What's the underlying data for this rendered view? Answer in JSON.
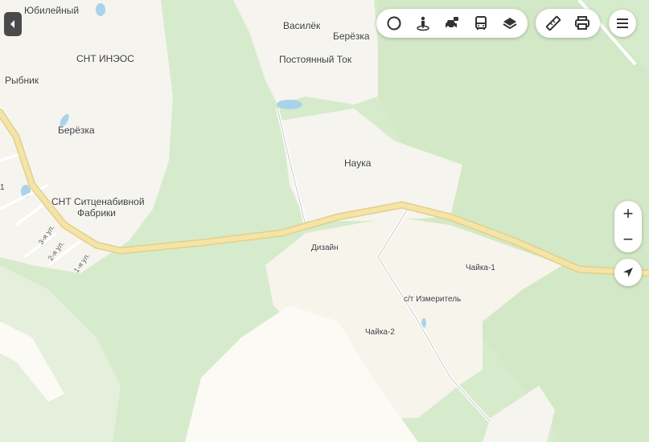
{
  "map": {
    "places": [
      {
        "id": "yubileyny",
        "text": "Юбилейный"
      },
      {
        "id": "snt-inzos",
        "text": "СНТ ИНЭОС"
      },
      {
        "id": "rybnik",
        "text": "Рыбник"
      },
      {
        "id": "beryozka-west",
        "text": "Берёзка"
      },
      {
        "id": "snt-sitcenabivnoy-1",
        "text": "СНТ Ситценабивной"
      },
      {
        "id": "snt-sitcenabivnoy-2",
        "text": "Фабрики"
      },
      {
        "id": "vasilyok",
        "text": "Василёк"
      },
      {
        "id": "beryozka-north",
        "text": "Берёзка"
      },
      {
        "id": "postoyanny-tok",
        "text": "Постоянный Ток"
      },
      {
        "id": "nauka",
        "text": "Наука"
      },
      {
        "id": "dizain",
        "text": "Дизайн"
      },
      {
        "id": "chayka-1",
        "text": "Чайка-1"
      },
      {
        "id": "st-izmeritel",
        "text": "с/т Измеритель"
      },
      {
        "id": "chayka-2",
        "text": "Чайка-2"
      },
      {
        "id": "edge-number",
        "text": "1"
      }
    ],
    "streets": [
      {
        "id": "street-3",
        "text": "3-я ул."
      },
      {
        "id": "street-2",
        "text": "2-я ул."
      },
      {
        "id": "street-1",
        "text": "1-я ул."
      }
    ]
  },
  "controls": {
    "top_layers": [
      "traffic-circle-icon",
      "panorama-person-icon",
      "car-sharing-icon",
      "bus-icon",
      "layers-icon"
    ],
    "tools": [
      "ruler-icon",
      "print-icon"
    ],
    "menu": "menu-icon",
    "zoom_in": "+",
    "zoom_out": "−",
    "locate": "location-arrow-icon",
    "collapse": "collapse-left-icon"
  },
  "colors": {
    "forest": "#d3e9c8",
    "meadow": "#e6f0e1",
    "settlement": "#f7f4ec",
    "road_main": "#f2e2a5",
    "road_minor": "#ffffff",
    "water": "#a9d3ea",
    "accent_icon": "#333333"
  }
}
